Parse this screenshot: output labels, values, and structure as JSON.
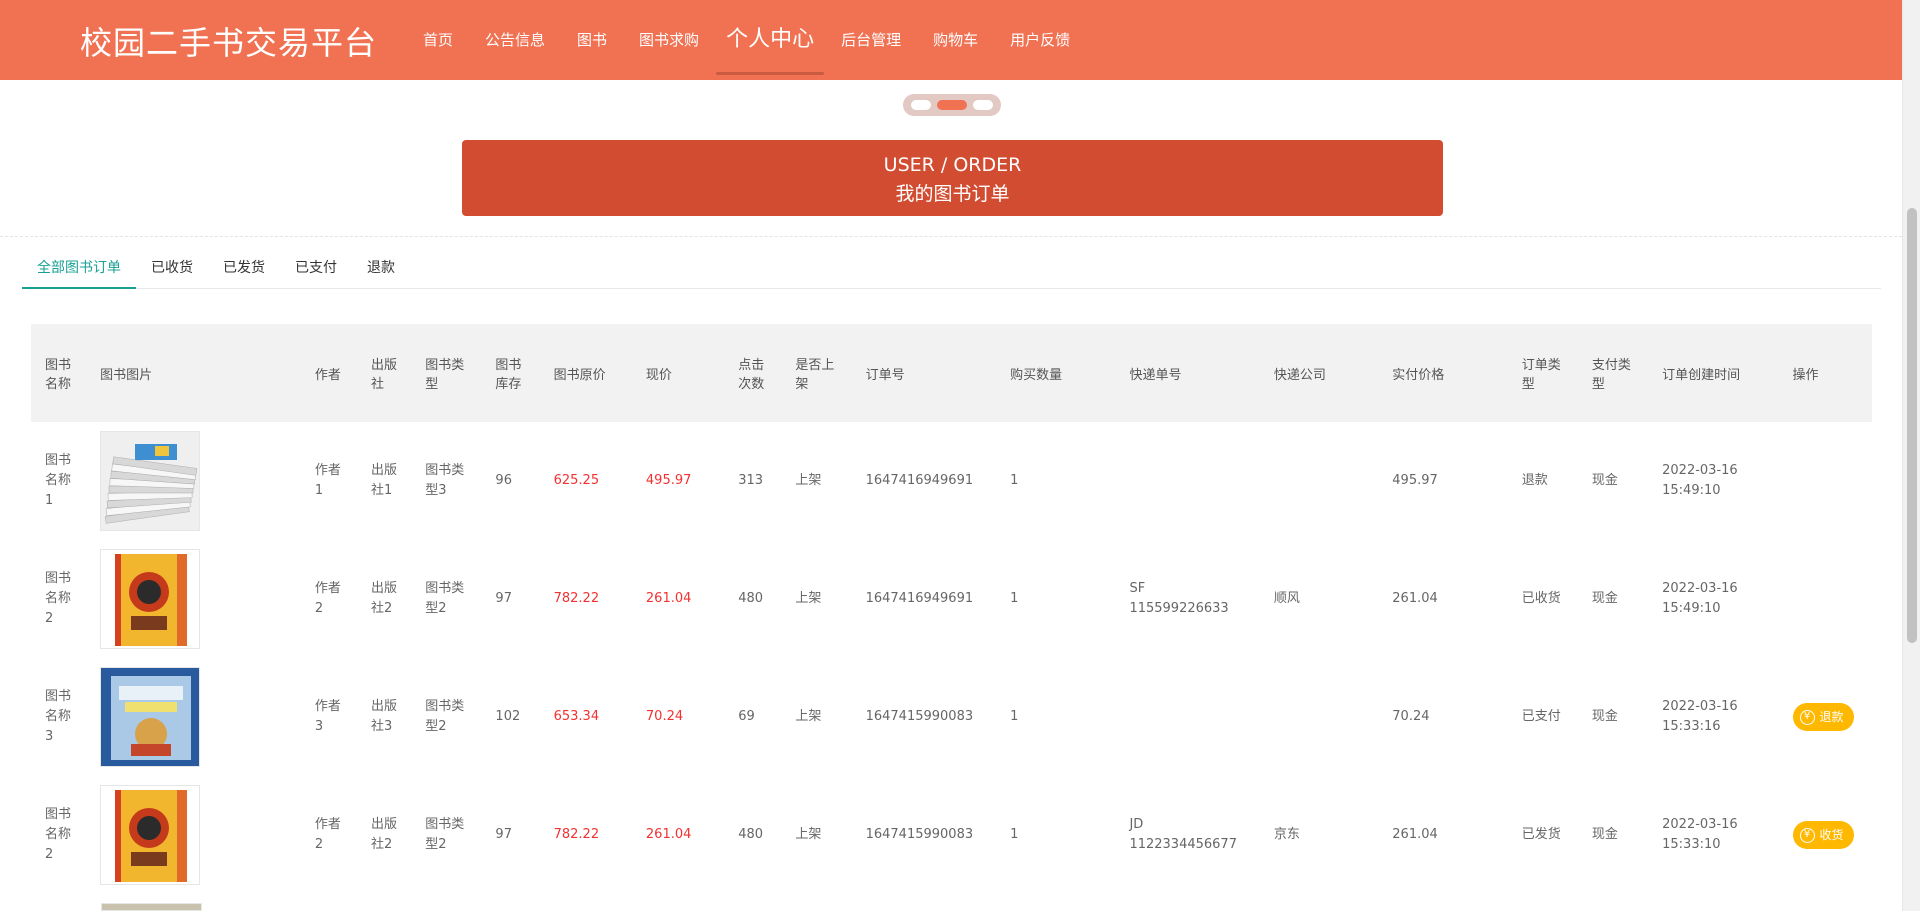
{
  "brand": "校园二手书交易平台",
  "nav": [
    "首页",
    "公告信息",
    "图书",
    "图书求购",
    "个人中心",
    "后台管理",
    "购物车",
    "用户反馈"
  ],
  "nav_active": "个人中心",
  "banner": {
    "en": "USER / ORDER",
    "zh": "我的图书订单"
  },
  "tabs": [
    "全部图书订单",
    "已收货",
    "已发货",
    "已支付",
    "退款"
  ],
  "tab_active": "全部图书订单",
  "columns": [
    "图书名称",
    "图书图片",
    "作者",
    "出版社",
    "图书类型",
    "图书库存",
    "图书原价",
    "现价",
    "点击次数",
    "是否上架",
    "订单号",
    "购买数量",
    "快递单号",
    "快递公司",
    "实付价格",
    "订单类型",
    "支付类型",
    "订单创建时间",
    "操作"
  ],
  "rows": [
    {
      "name": "图书名称1",
      "author": "作者1",
      "publisher": "出版社1",
      "type": "图书类型3",
      "stock": "96",
      "orig_price": "625.25",
      "price": "495.97",
      "clicks": "313",
      "listed": "上架",
      "order_no": "1647416949691",
      "qty": "1",
      "tracking": "",
      "courier": "",
      "paid": "495.97",
      "order_type": "退款",
      "pay_type": "现金",
      "created": "2022-03-16 15:49:10",
      "action": "",
      "cover": "stack"
    },
    {
      "name": "图书名称2",
      "author": "作者2",
      "publisher": "出版社2",
      "type": "图书类型2",
      "stock": "97",
      "orig_price": "782.22",
      "price": "261.04",
      "clicks": "480",
      "listed": "上架",
      "order_no": "1647416949691",
      "qty": "1",
      "tracking": "SF 115599226633",
      "courier": "顺风",
      "paid": "261.04",
      "order_type": "已收货",
      "pay_type": "现金",
      "created": "2022-03-16 15:49:10",
      "action": "",
      "cover": "yellow"
    },
    {
      "name": "图书名称3",
      "author": "作者3",
      "publisher": "出版社3",
      "type": "图书类型2",
      "stock": "102",
      "orig_price": "653.34",
      "price": "70.24",
      "clicks": "69",
      "listed": "上架",
      "order_no": "1647415990083",
      "qty": "1",
      "tracking": "",
      "courier": "",
      "paid": "70.24",
      "order_type": "已支付",
      "pay_type": "现金",
      "created": "2022-03-16 15:33:16",
      "action": "退款",
      "cover": "blue"
    },
    {
      "name": "图书名称2",
      "author": "作者2",
      "publisher": "出版社2",
      "type": "图书类型2",
      "stock": "97",
      "orig_price": "782.22",
      "price": "261.04",
      "clicks": "480",
      "listed": "上架",
      "order_no": "1647415990083",
      "qty": "1",
      "tracking": "JD 1122334456677",
      "courier": "京东",
      "paid": "261.04",
      "order_type": "已发货",
      "pay_type": "现金",
      "created": "2022-03-16 15:33:10",
      "action": "收货",
      "cover": "yellow"
    }
  ],
  "action_icon": "yen-icon",
  "colors": {
    "header": "#f07253",
    "banner": "#d24c32",
    "tab_active": "#1aa094",
    "price": "#f23131",
    "action_button": "#ffb800"
  }
}
